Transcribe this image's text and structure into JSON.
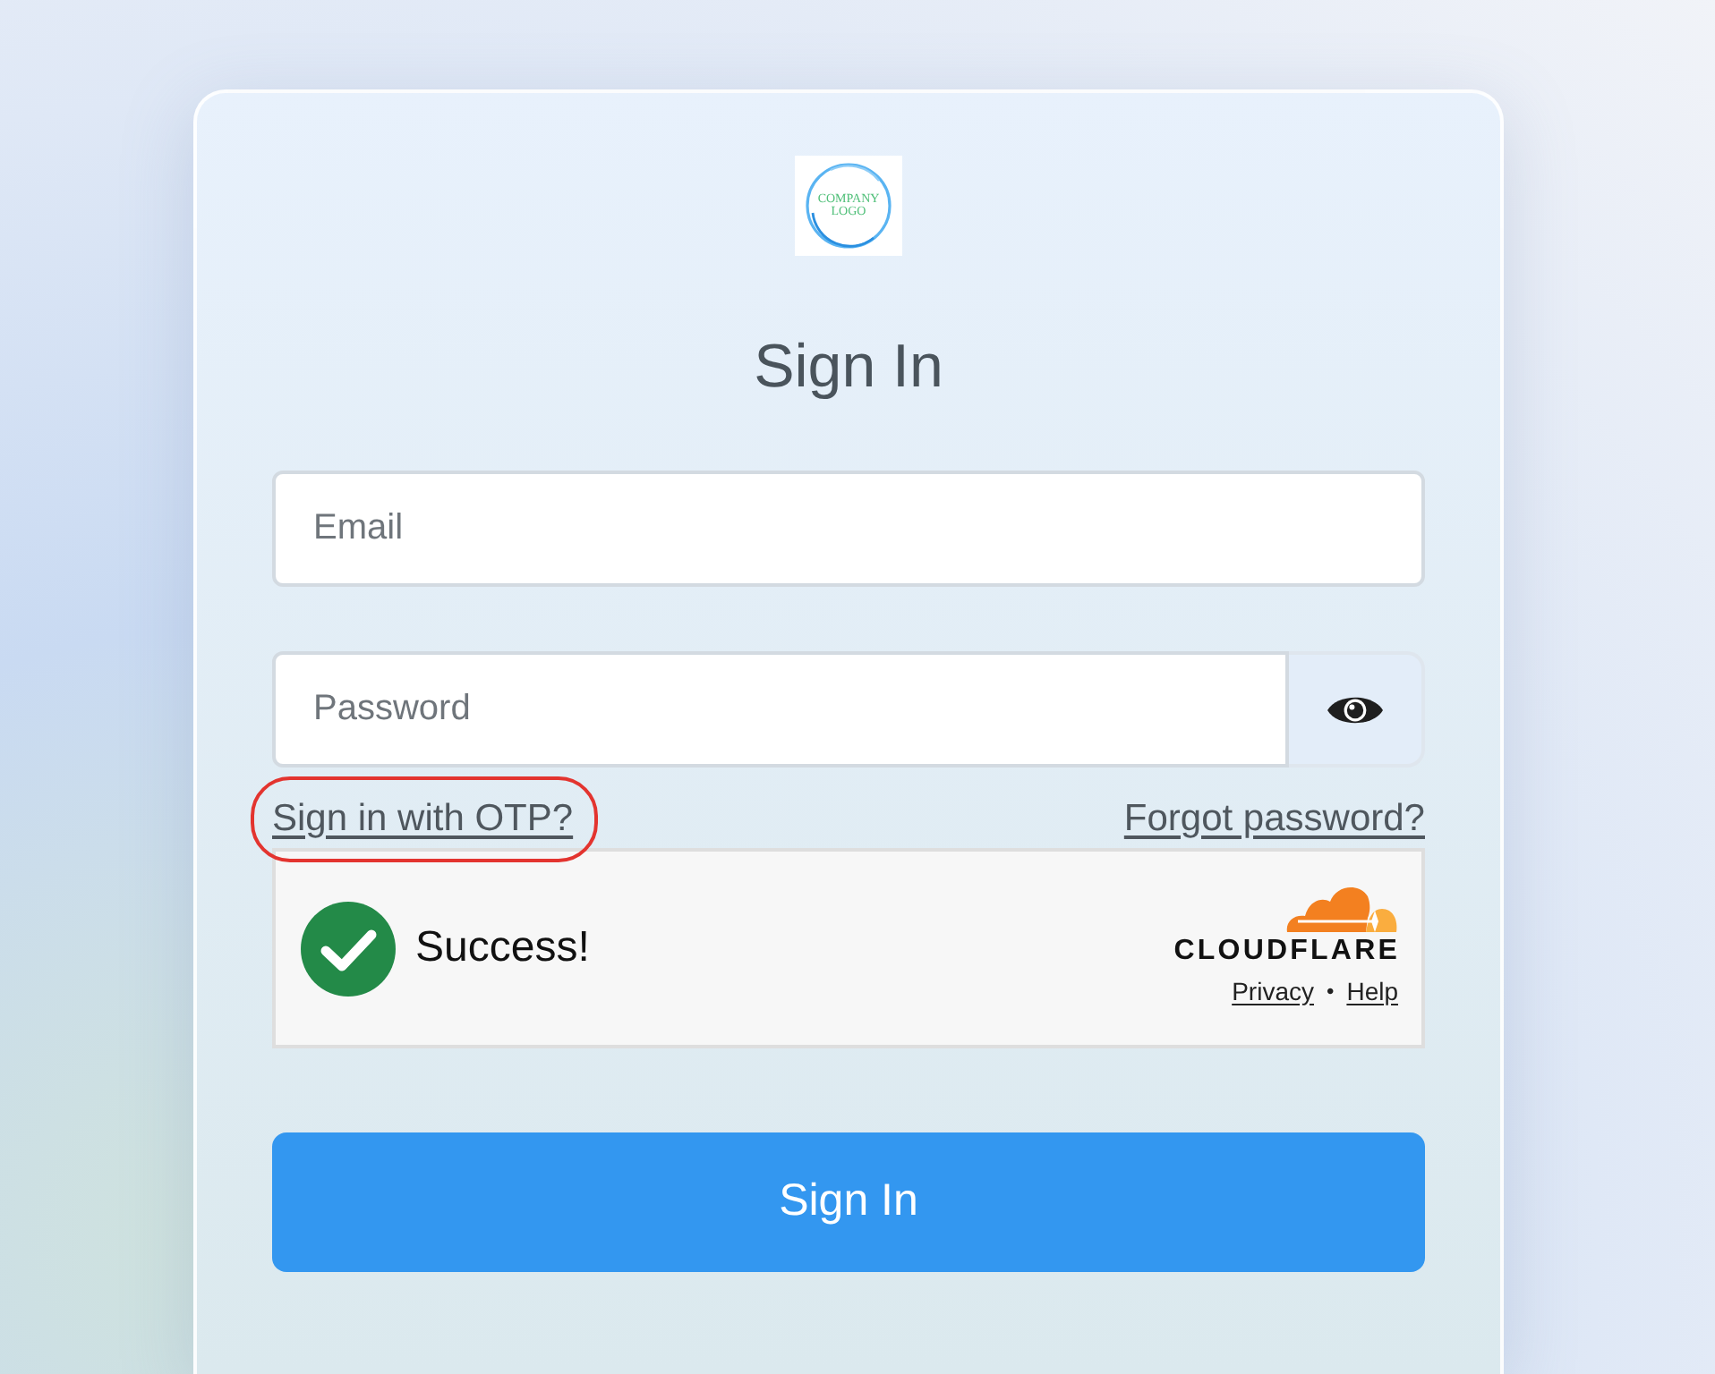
{
  "logo": {
    "lines": [
      "COMPANY",
      "LOGO"
    ]
  },
  "title": "Sign In",
  "email_field": {
    "placeholder": "Email"
  },
  "password_field": {
    "placeholder": "Password"
  },
  "links": [
    {
      "label": "Sign in with OTP?",
      "highlighted": true
    },
    {
      "label": "Forgot password?",
      "highlighted": false
    }
  ],
  "captcha": {
    "verified": true,
    "message": "Success!",
    "provider": "CLOUDFLARE",
    "links": [
      "Privacy",
      "Help"
    ],
    "separator": "•"
  },
  "submit_button": {
    "label": "Sign In"
  }
}
